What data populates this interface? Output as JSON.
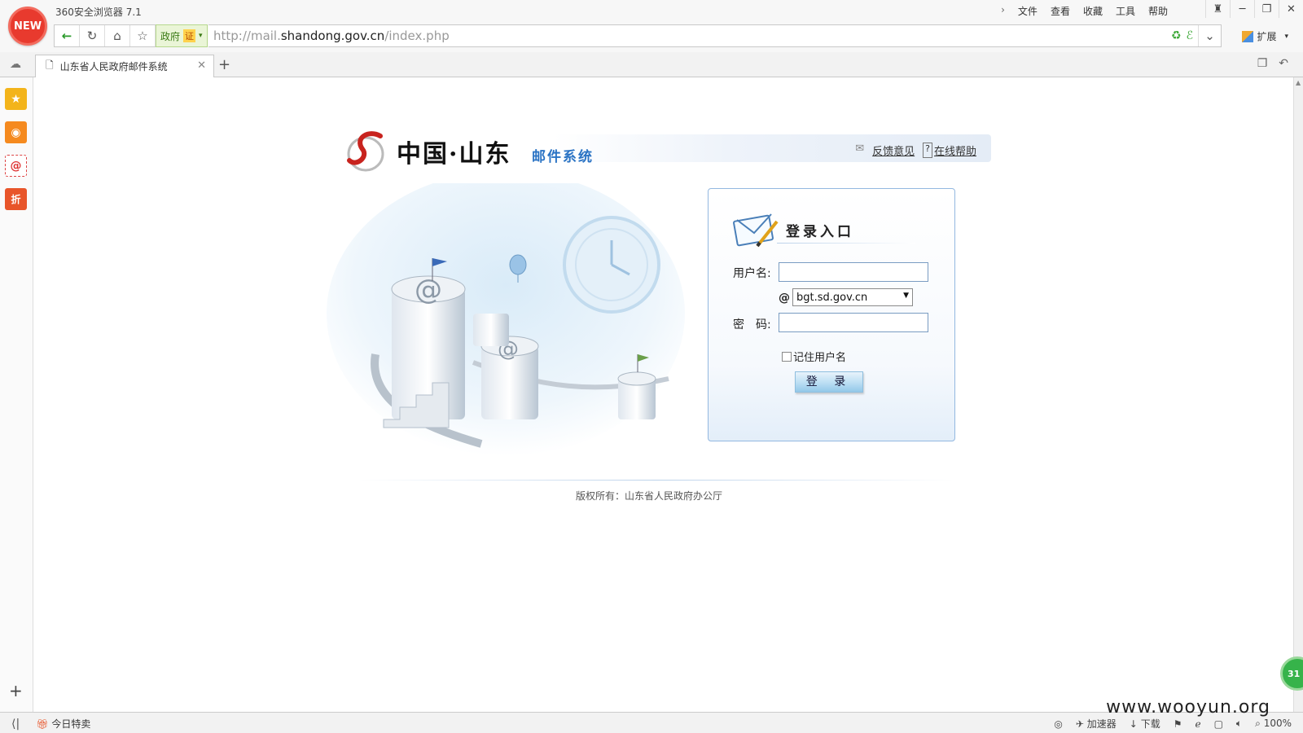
{
  "browser": {
    "app_title": "360安全浏览器 7.1",
    "new_badge": "NEW",
    "menu": [
      "文件",
      "查看",
      "收藏",
      "工具",
      "帮助"
    ],
    "gov_badge": "政府",
    "cert_badge": "证",
    "url": {
      "scheme": "http://mail.",
      "host": "shandong.gov.cn",
      "path": "/index.php"
    },
    "extensions_label": "扩展",
    "tab_title": "山东省人民政府邮件系统",
    "status_left": "今日特卖",
    "status_right": [
      "加速器",
      "下载",
      "100%"
    ],
    "float_badge": "31",
    "watermark": "www.wooyun.org"
  },
  "page": {
    "logo_main": "中国·山东",
    "logo_sub": "邮件系统",
    "links": {
      "feedback": "反馈意见",
      "help": "在线帮助"
    },
    "login": {
      "title": "登录入口",
      "username_label": "用户名:",
      "username_value": "",
      "at": "@",
      "domain_selected": "bgt.sd.gov.cn",
      "password_label": "密　码:",
      "password_value": "",
      "remember_label": "记住用户名",
      "remember_checked": false,
      "submit_label": "登 录"
    },
    "copyright": "版权所有：山东省人民政府办公厅"
  },
  "colors": {
    "accent_blue": "#2a73c4",
    "login_border": "#93b8e0",
    "brand_red": "#c8231e"
  }
}
